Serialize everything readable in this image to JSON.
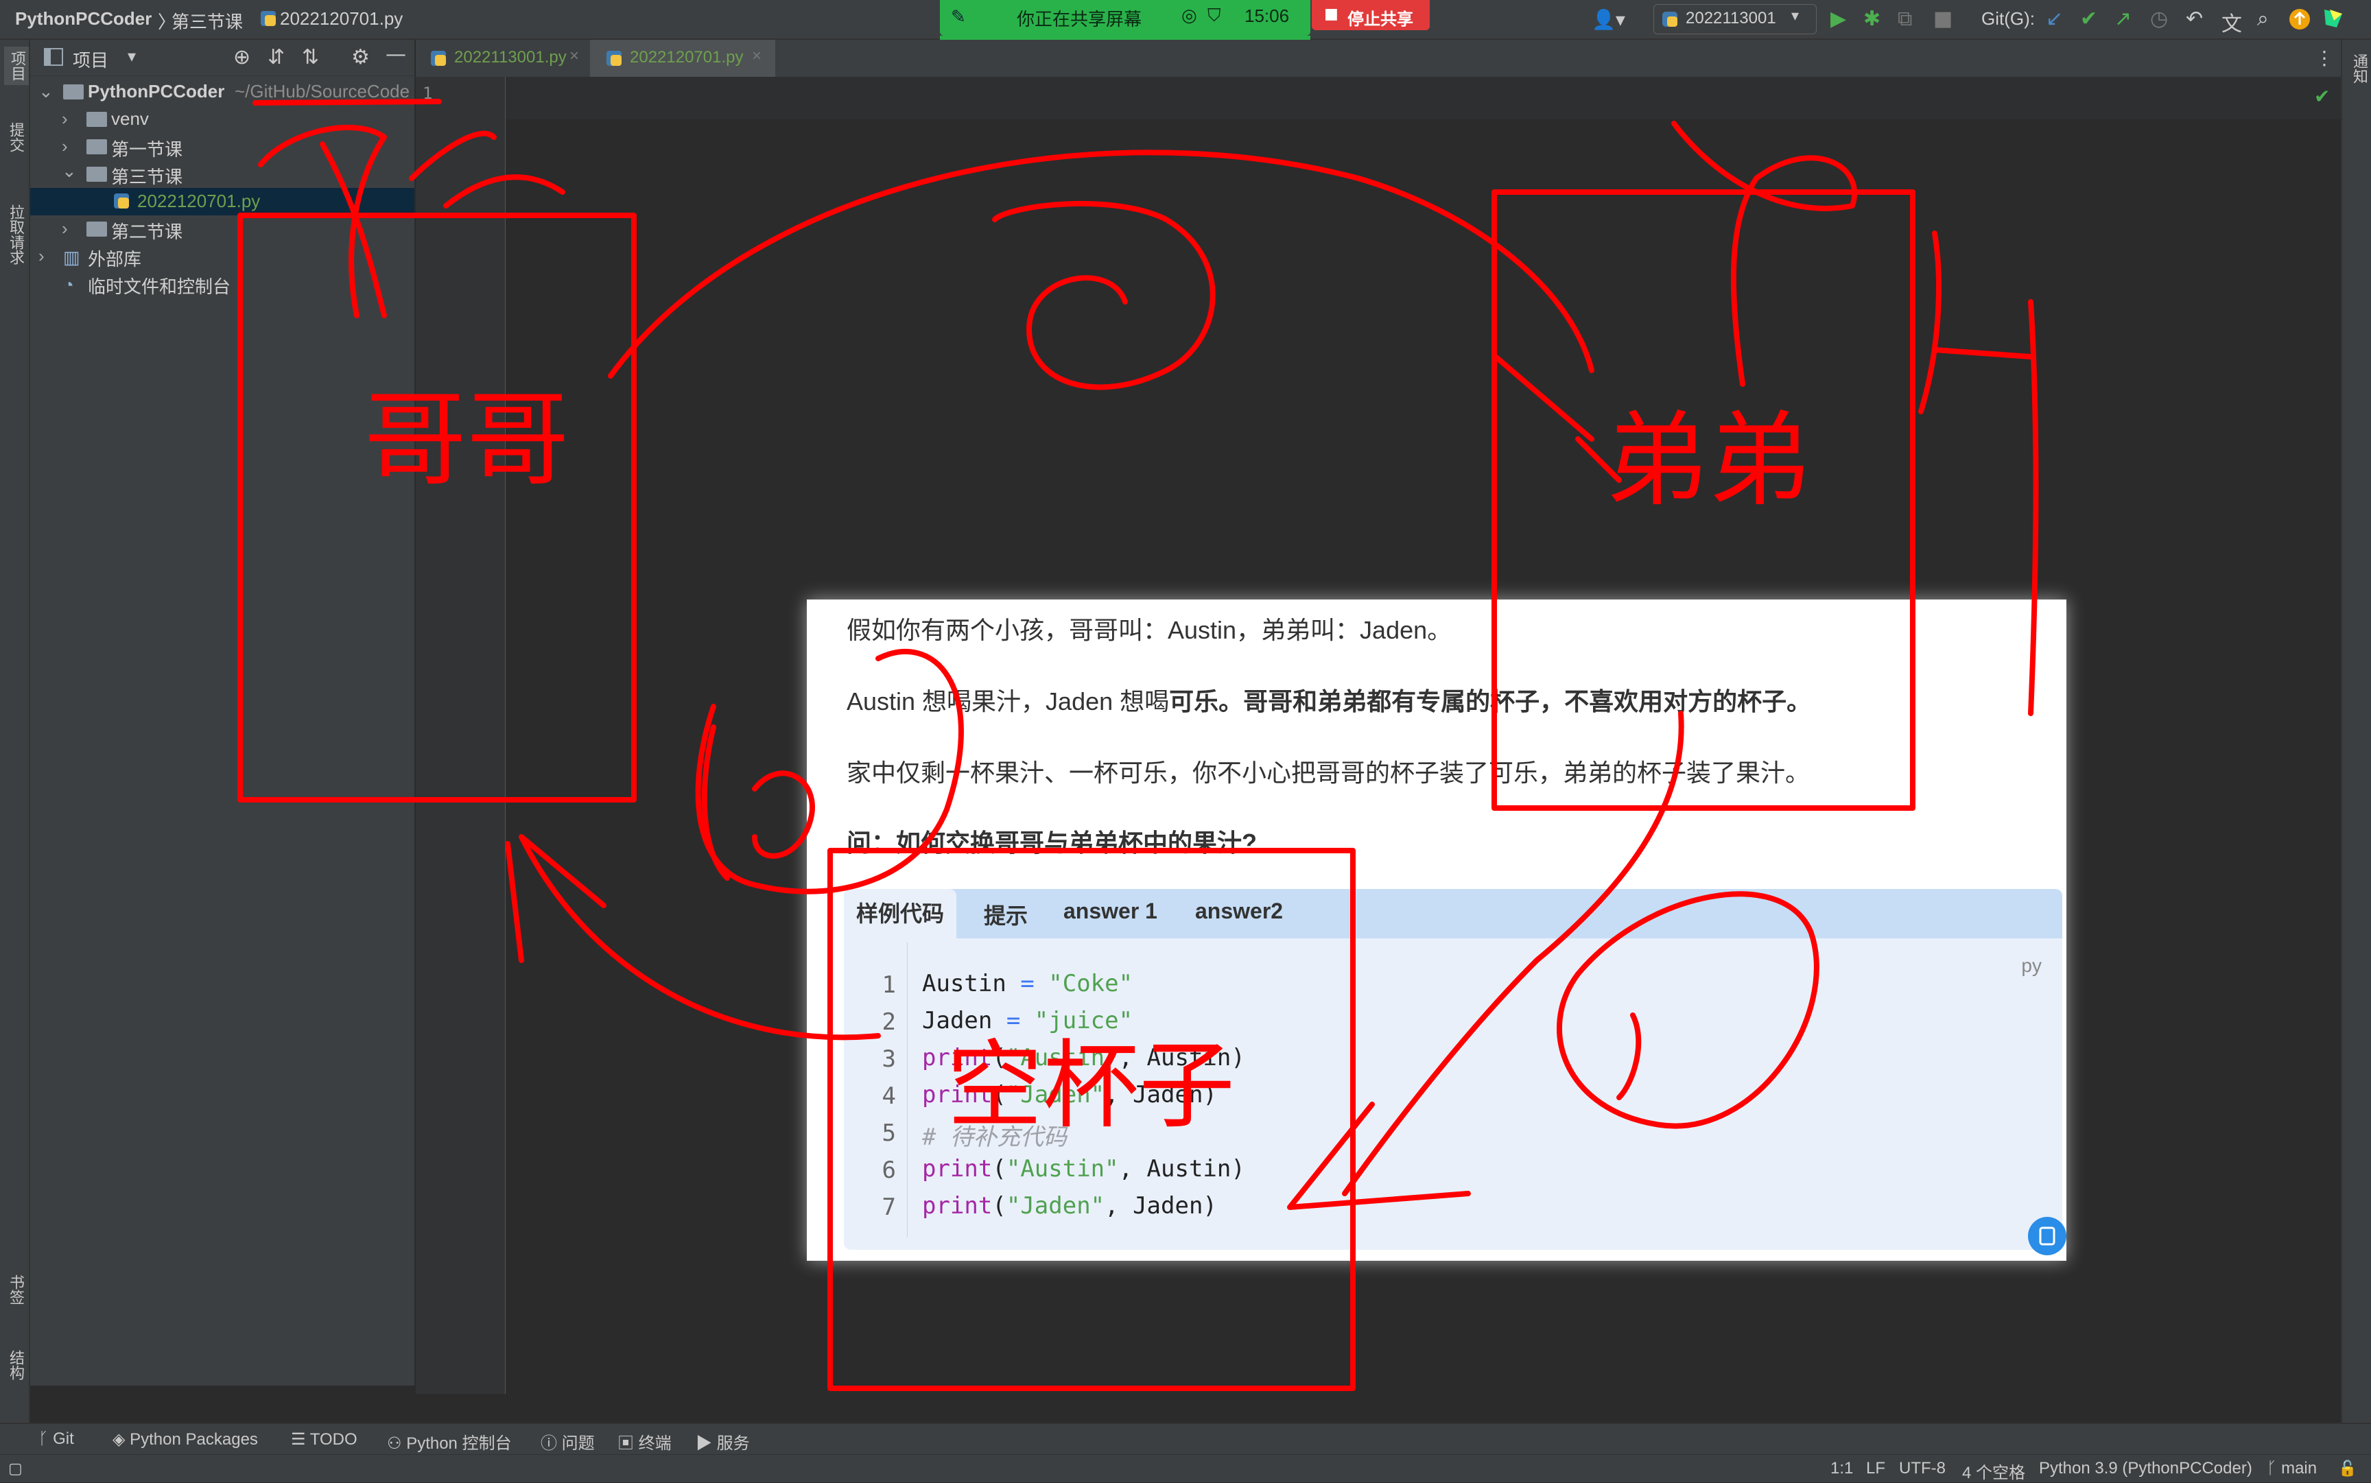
{
  "titlebar": {
    "project": "PythonPCCoder",
    "folder": "第三节课",
    "file": "2022120701.py",
    "run_config": "2022113001",
    "git_label": "Git(G):"
  },
  "share_banner": {
    "text": "你正在共享屏幕",
    "time": "15:06",
    "stop_label": "停止共享"
  },
  "left_tools": {
    "project": "项目",
    "commit": "提交",
    "pull_requests": "拉取请求",
    "bookmarks": "书签",
    "structure": "结构"
  },
  "right_tools": {
    "notifications": "通知"
  },
  "project_panel": {
    "title": "项目",
    "root_name": "PythonPCCoder",
    "root_path": "~/GitHub/SourceCode",
    "items": [
      {
        "label": "venv"
      },
      {
        "label": "第一节课"
      },
      {
        "label": "第三节课"
      },
      {
        "label": "2022120701.py"
      },
      {
        "label": "第二节课"
      },
      {
        "label": "外部库"
      },
      {
        "label": "临时文件和控制台"
      }
    ]
  },
  "tabs": [
    {
      "label": "2022113001.py"
    },
    {
      "label": "2022120701.py"
    }
  ],
  "editor": {
    "first_line_no": "1"
  },
  "doc": {
    "p1": "假如你有两个小孩，哥哥叫：Austin，弟弟叫：Jaden。",
    "p2_a": "Austin 想喝果汁，Jaden 想喝",
    "p2_b": "可乐。哥哥和弟弟都有专属的杯子，不喜欢用对方的杯子。",
    "p3": "家中仅剩一杯果汁、一杯可乐，你不小心把哥哥的杯子装了可乐，弟弟的杯子装了果汁。",
    "p4": "问：如何交换哥哥与弟弟杯中的果汁?",
    "code_tabs": [
      "样例代码",
      "提示",
      "answer 1",
      "answer2"
    ],
    "lang": "py",
    "code_lines": [
      {
        "no": "1",
        "text": "Austin = \"Coke\""
      },
      {
        "no": "2",
        "text": "Jaden = \"juice\""
      },
      {
        "no": "3",
        "text": "print(\"Austin\", Austin)"
      },
      {
        "no": "4",
        "text": "print(\"Jaden\", Jaden)"
      },
      {
        "no": "5",
        "text": "# 待补充代码"
      },
      {
        "no": "6",
        "text": "print(\"Austin\", Austin)"
      },
      {
        "no": "7",
        "text": "print(\"Jaden\", Jaden)"
      }
    ]
  },
  "annotations": {
    "gege": "哥哥",
    "didi": "弟弟",
    "empty_cup": "空杯子",
    "ink_color": "#ff0000"
  },
  "bottom_tools": {
    "git": "Git",
    "packages": "Python Packages",
    "todo": "TODO",
    "console": "Python 控制台",
    "problems": "问题",
    "terminal": "终端",
    "services": "服务"
  },
  "status": {
    "pos": "1:1",
    "lf": "LF",
    "encoding": "UTF-8",
    "indent": "4 个空格",
    "interpreter": "Python 3.9 (PythonPCCoder)",
    "branch": "main"
  }
}
